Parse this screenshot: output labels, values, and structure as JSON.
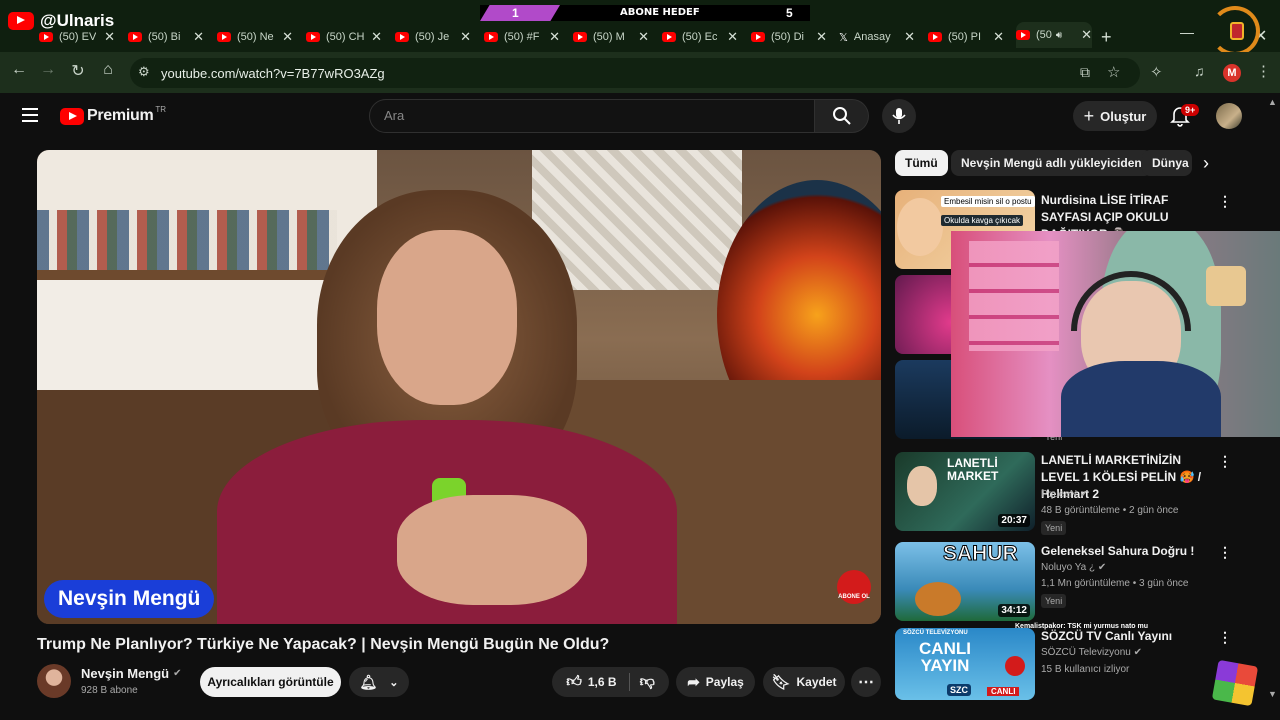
{
  "overlay": {
    "channel_handle": "@Ulnaris",
    "goal_left": "1",
    "goal_label": "ABONE HEDEF",
    "goal_right": "5"
  },
  "browser": {
    "tabs": [
      {
        "label": "(50) EV",
        "icon": "youtube-icon"
      },
      {
        "label": "(50) Bi",
        "icon": "youtube-icon"
      },
      {
        "label": "(50) Ne",
        "icon": "youtube-icon"
      },
      {
        "label": "(50) CH",
        "icon": "youtube-icon"
      },
      {
        "label": "(50) Je",
        "icon": "youtube-icon"
      },
      {
        "label": "(50) #F",
        "icon": "youtube-icon"
      },
      {
        "label": "(50) M",
        "icon": "youtube-icon"
      },
      {
        "label": "(50) Ec",
        "icon": "youtube-icon"
      },
      {
        "label": "(50) Di",
        "icon": "youtube-icon"
      },
      {
        "label": "Anasay",
        "icon": "x-icon"
      },
      {
        "label": "(50) PI",
        "icon": "youtube-icon"
      },
      {
        "label": "(50",
        "icon": "youtube-icon"
      }
    ],
    "url": "youtube.com/watch?v=7B77wRO3AZg",
    "profile_initial": "M"
  },
  "youtube": {
    "logo_text": "Premium",
    "logo_country": "TR",
    "search_placeholder": "Ara",
    "create_label": "Oluştur",
    "notifications_badge": "9+"
  },
  "video": {
    "lower_third_name": "Nevşin Mengü",
    "subscribe_badge": "ABONE OL",
    "title": "Trump Ne Planlıyor? Türkiye Ne Yapacak? | Nevşin Mengü Bugün Ne Oldu?",
    "channel": "Nevşin Mengü",
    "subscribers": "928 B abone",
    "memberships_label": "Ayrıcalıkları görüntüle",
    "likes": "1,6 B",
    "share_label": "Paylaş",
    "save_label": "Kaydet"
  },
  "filter_chips": [
    "Tümü",
    "Nevşin Mengü adlı yükleyiciden",
    "Dünya"
  ],
  "recommendations": [
    {
      "title": "Nurdisina LİSE İTİRAF SAYFASI AÇIP OKULU DAĞITIYOR 🗿...",
      "thumb_caption_1": "Embesil misin sil o postu",
      "thumb_caption_2": "Okulda kavga çıkıcak"
    },
    {
      "title": "LANETLİ MARKETİNİZİN LEVEL 1 KÖLESİ PELİN 🥵 / Hellmart 2",
      "channel": "PqueeN",
      "meta": "48 B görüntüleme • 2 gün önce",
      "badge": "Yeni",
      "duration": "20:37",
      "thumb_text": "LANETLİ MARKET"
    },
    {
      "title": "Geleneksel Sahura Doğru !",
      "channel": "Noluyo Ya ¿",
      "meta": "1,1 Mn görüntüleme • 3 gün önce",
      "badge": "Yeni",
      "duration": "34:12",
      "thumb_text": "SAHUR"
    },
    {
      "title": "SÖZCÜ TV Canlı Yayını",
      "channel": "SÖZCÜ Televizyonu",
      "meta": "15 B kullanıcı izliyor",
      "thumb_text_1": "CANLI YAYIN",
      "thumb_text_2": "CANLI",
      "thumb_header": "SÖZCÜ TELEVİZYONU",
      "thumb_logo": "SZC"
    }
  ],
  "partial_badge": "Yeni",
  "chat_overlay": "Kemalistpakor: TSK mi yurmus nato mu"
}
